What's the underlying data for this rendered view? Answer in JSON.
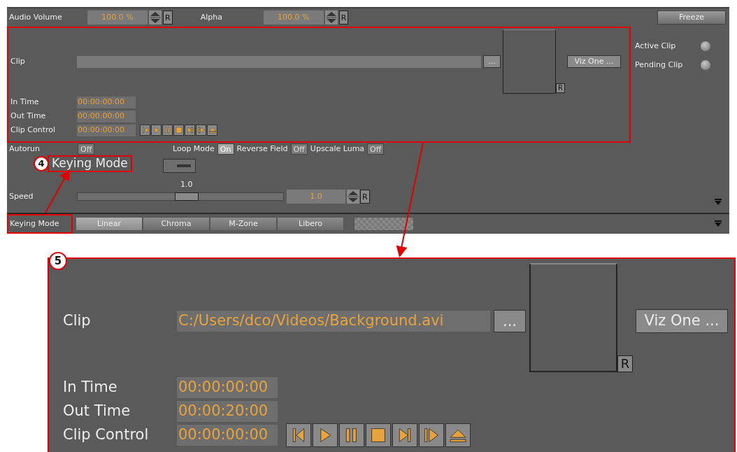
{
  "top_bar": {
    "audio_volume": {
      "label": "Audio Volume",
      "value": "100.0 %",
      "reset": "R"
    },
    "alpha": {
      "label": "Alpha",
      "value": "100.0 %",
      "reset": "R"
    },
    "freeze": "Freeze"
  },
  "clip": {
    "label": "Clip",
    "browse": "...",
    "preview_reset": "R",
    "viz_one": "Viz One ...",
    "times": [
      {
        "label": "In Time",
        "value": "00:00:00:00"
      },
      {
        "label": "Out Time",
        "value": "00:00:00:00"
      },
      {
        "label": "Clip Control",
        "value": "00:00:00:00"
      }
    ],
    "transport": [
      {
        "kind": "first"
      },
      {
        "kind": "play"
      },
      {
        "kind": "pause"
      },
      {
        "kind": "stop"
      },
      {
        "kind": "next"
      },
      {
        "kind": "last"
      },
      {
        "kind": "eject"
      }
    ]
  },
  "status": [
    {
      "label": "Active Clip"
    },
    {
      "label": "Pending Clip"
    }
  ],
  "toggles": [
    {
      "label": "Autorun",
      "value": "Off",
      "on": false
    },
    {
      "label": "Loop Mode",
      "value": "On",
      "on": true
    },
    {
      "label": "Reverse Field",
      "value": "Off",
      "on": false
    },
    {
      "label": "Upscale Luma",
      "value": "Off",
      "on": false
    }
  ],
  "speed": {
    "label": "Speed",
    "slider_value": "1.0",
    "level": 0.53,
    "value": "1.0",
    "reset": "R"
  },
  "keying_mode": {
    "label": "Keying Mode",
    "tabs": [
      {
        "label": "Linear",
        "selected": true
      },
      {
        "label": "Chroma",
        "selected": false
      },
      {
        "label": "M-Zone",
        "selected": false
      },
      {
        "label": "Libero",
        "selected": false
      }
    ]
  },
  "callout_4": {
    "number": "4",
    "text": "Keying Mode"
  },
  "detail_5": {
    "number": "5",
    "clip_label": "Clip",
    "clip_path": "C:/Users/dco/Videos/Background.avi",
    "browse": "...",
    "preview_reset": "R",
    "viz_one": "Viz One ...",
    "times": [
      {
        "label": "In Time",
        "value": "00:00:00:00"
      },
      {
        "label": "Out Time",
        "value": "00:00:20:00"
      },
      {
        "label": "Clip Control",
        "value": "00:00:00:00"
      }
    ],
    "transport": [
      {
        "kind": "first"
      },
      {
        "kind": "play"
      },
      {
        "kind": "pause"
      },
      {
        "kind": "stop"
      },
      {
        "kind": "next"
      },
      {
        "kind": "last"
      },
      {
        "kind": "eject"
      }
    ]
  }
}
